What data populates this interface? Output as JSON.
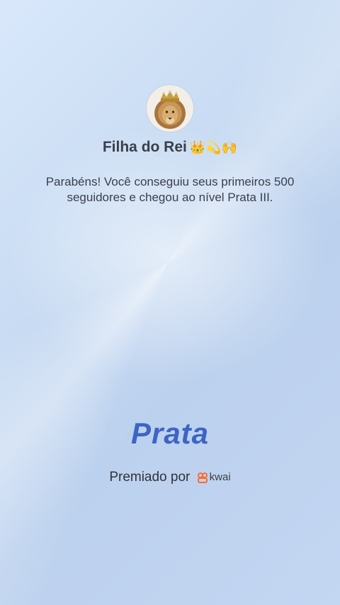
{
  "profile": {
    "name": "Filha do Rei",
    "name_emoji": "👑💫🙌",
    "avatar_icon": "lion-with-crown"
  },
  "message": "Parabéns! Você conseguiu seus primeiros 500 seguidores e chegou ao nível Prata III.",
  "level": {
    "label": "Prata",
    "color": "#3e64c4"
  },
  "footer": {
    "awarded_by": "Premiado por",
    "brand": "kwai",
    "brand_color": "#ff6a2b"
  }
}
